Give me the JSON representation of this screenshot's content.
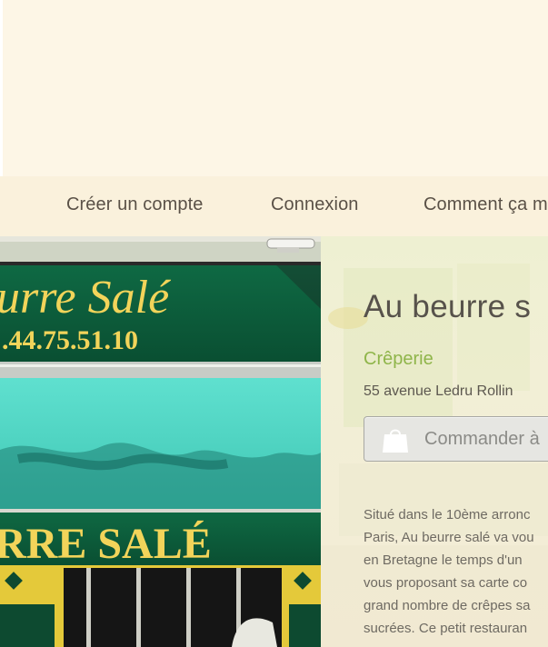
{
  "nav": {
    "items": [
      {
        "label": "Créer un compte"
      },
      {
        "label": "Connexion"
      },
      {
        "label": "Comment ça m"
      }
    ]
  },
  "photo": {
    "sign_top_text": "urre Salé",
    "phone_text": ".44.75.51.10",
    "sign_bottom_text": "RRE SALÉ"
  },
  "restaurant": {
    "name": "Au beurre s",
    "category": "Crêperie",
    "address": "55 avenue Ledru Rollin",
    "order_button": "Commander à",
    "description_lines": [
      "Situé dans le 10ème arronc",
      "Paris, Au beurre salé va vou",
      "en Bretagne le temps d'un",
      "vous proposant sa carte co",
      "grand nombre de crêpes sa",
      "sucrées. Ce petit restauran"
    ]
  },
  "colors": {
    "accent_green": "#8fb54a",
    "sign_green": "#0d5a3a",
    "sign_yellow": "#f2d45a",
    "awning_turquoise": "#4fd6c3"
  }
}
